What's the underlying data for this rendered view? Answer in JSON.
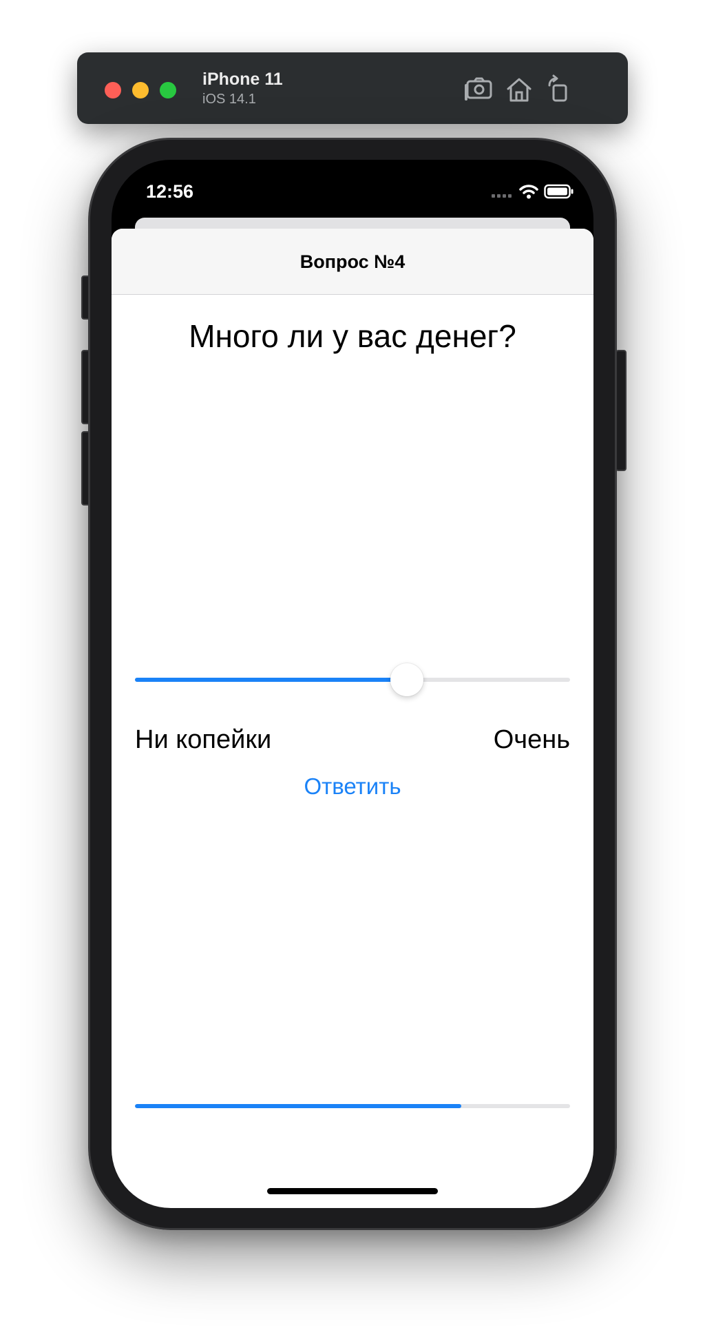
{
  "simulator": {
    "device_name": "iPhone 11",
    "os_version": "iOS 14.1",
    "buttons": [
      {
        "icon": "screenshot-icon"
      },
      {
        "icon": "home-icon"
      },
      {
        "icon": "rotate-icon"
      }
    ]
  },
  "status_bar": {
    "time": "12:56",
    "icons": [
      "cellular-signal-icon",
      "wifi-icon",
      "battery-icon"
    ]
  },
  "nav": {
    "title": "Вопрос №4"
  },
  "question": {
    "text": "Много ли у вас денег?"
  },
  "slider": {
    "value": 0.625,
    "min_label": "Ни копейки",
    "max_label": "Очень"
  },
  "answer_button": {
    "label": "Ответить"
  },
  "progress": {
    "value": 0.75
  },
  "colors": {
    "accent": "#1a82f7",
    "track": "#e4e4e6",
    "nav_background": "#f6f6f6",
    "simulator_bar": "#2b2e30"
  }
}
